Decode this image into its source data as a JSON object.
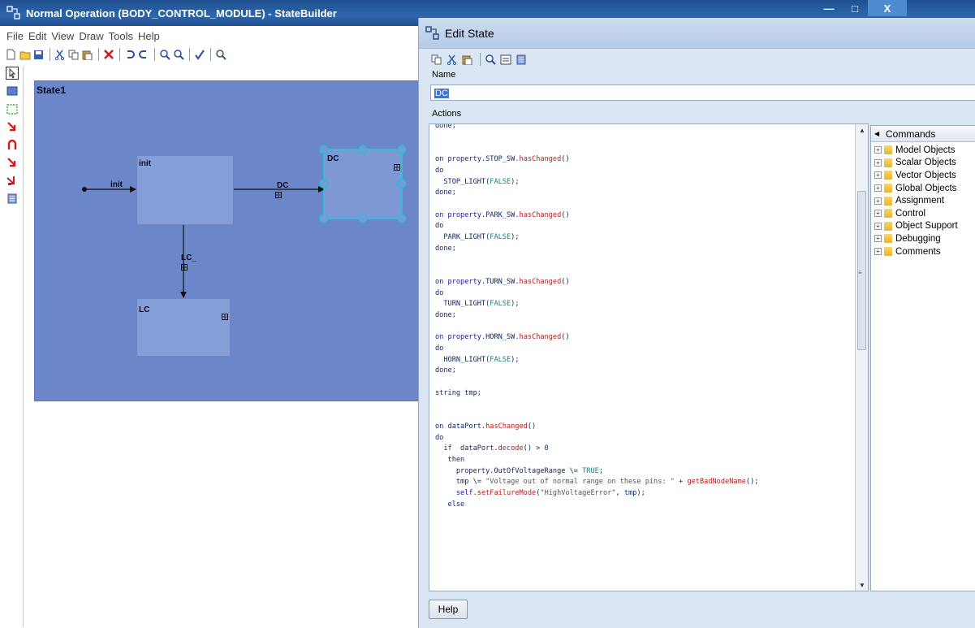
{
  "main_window": {
    "title": "Normal Operation (BODY_CONTROL_MODULE) - StateBuilder",
    "controls": {
      "minimize": "—",
      "maximize": "□",
      "close": "X"
    },
    "menu": [
      "File",
      "Edit",
      "View",
      "Draw",
      "Tools",
      "Help"
    ],
    "toolbar_icons": [
      "new-icon",
      "open-icon",
      "save-icon",
      "cut-icon",
      "copy-icon",
      "paste-icon",
      "delete-icon",
      "undo-icon",
      "redo-icon",
      "zoom-in-icon",
      "zoom-out-icon",
      "validate-icon",
      "find-icon"
    ],
    "left_tools": [
      "pointer-icon",
      "state-icon",
      "selection-state-icon",
      "transition-icon",
      "self-transition-icon",
      "junction-transition-icon",
      "branch-transition-icon",
      "note-icon"
    ]
  },
  "diagram": {
    "container_label": "State1",
    "states": {
      "init": "init",
      "lc": "LC",
      "dc": "DC"
    },
    "transitions": {
      "init": "init",
      "dc": "DC",
      "lc": "LC_"
    }
  },
  "edit_state": {
    "title": "Edit State",
    "name_label": "Name",
    "name_value": "DC",
    "actions_label": "Actions",
    "code_lines": [
      "done;",
      "",
      "",
      "on property.STOP_SW.hasChanged()",
      "do",
      "  STOP_LIGHT(FALSE);",
      "done;",
      "",
      "on property.PARK_SW.hasChanged()",
      "do",
      "  PARK_LIGHT(FALSE);",
      "done;",
      "",
      "",
      "on property.TURN_SW.hasChanged()",
      "do",
      "  TURN_LIGHT(FALSE);",
      "done;",
      "",
      "on property.HORN_SW.hasChanged()",
      "do",
      "  HORN_LIGHT(FALSE);",
      "done;",
      "",
      "string tmp;",
      "",
      "",
      "on dataPort.hasChanged()",
      "do",
      "  if  dataPort.decode() > 0",
      "   then",
      "     property.OutOfVoltageRange \\= TRUE;",
      "     tmp \\= \"Voltage out of normal range on these pins: \" + getBadNodeName();",
      "     self.setFailureMode(\"HighVoltageError\", tmp);",
      "   else"
    ],
    "commands": {
      "header": "Commands",
      "items": [
        "Model Objects",
        "Scalar Objects",
        "Vector Objects",
        "Global Objects",
        "Assignment",
        "Control",
        "Object Support",
        "Debugging",
        "Comments"
      ]
    },
    "help_button": "Help"
  }
}
